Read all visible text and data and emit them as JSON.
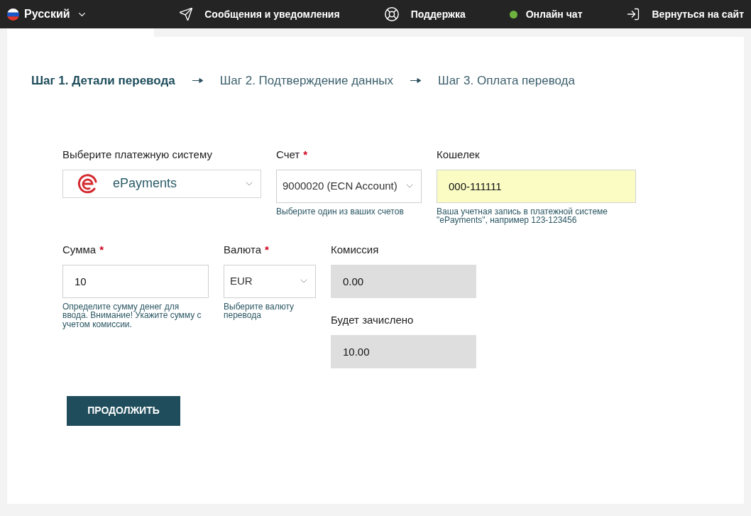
{
  "header": {
    "language": {
      "label": "Русский"
    },
    "nav": [
      {
        "kind": "messages",
        "label": "Сообщения и уведомления"
      },
      {
        "kind": "support",
        "label": "Поддержка"
      },
      {
        "kind": "chat",
        "label": "Онлайн чат",
        "online": true
      },
      {
        "kind": "return",
        "label": "Вернуться на сайт"
      }
    ]
  },
  "steps": [
    {
      "label": "Шаг 1. Детали перевода",
      "selected": true
    },
    {
      "label": "Шаг 2. Подтверждение данных",
      "selected": false
    },
    {
      "label": "Шаг 3. Оплата перевода",
      "selected": false
    }
  ],
  "form": {
    "rows": [
      {
        "columns": [
          [
            {
              "kind": "logo_select",
              "label": "Выберите платежную систему",
              "value": "ePayments"
            }
          ],
          [
            {
              "kind": "select",
              "label": "Счет",
              "required_mark": "*",
              "value": "9000020 (ECN Account)",
              "hint": "Выберите один из ваших счетов"
            }
          ],
          [
            {
              "kind": "input",
              "label": "Кошелек",
              "value": "000-111111",
              "highlighted": true,
              "disabled": false,
              "hint": "Ваша учетная запись в платежной системе \"ePayments\", например 123-123456"
            }
          ]
        ]
      },
      {
        "columns": [
          [
            {
              "kind": "input",
              "label": "Сумма",
              "required_mark": "*",
              "value": "10",
              "highlighted": false,
              "disabled": false,
              "hint": "Определите сумму денег для ввода. Внимание! Укажите сумму с учетом комиссии."
            }
          ],
          [
            {
              "kind": "select",
              "label": "Валюта",
              "required_mark": "*",
              "value": "EUR",
              "hint": "Выберите валюту перевода"
            }
          ],
          [
            {
              "kind": "input",
              "label": "Комиссия",
              "value": "0.00",
              "disabled": true
            },
            {
              "kind": "input",
              "label": "Будет зачислено",
              "value": "10.00",
              "disabled": true
            }
          ]
        ]
      }
    ]
  },
  "submit_button": {
    "label": "ПРОДОЛЖИТЬ"
  }
}
